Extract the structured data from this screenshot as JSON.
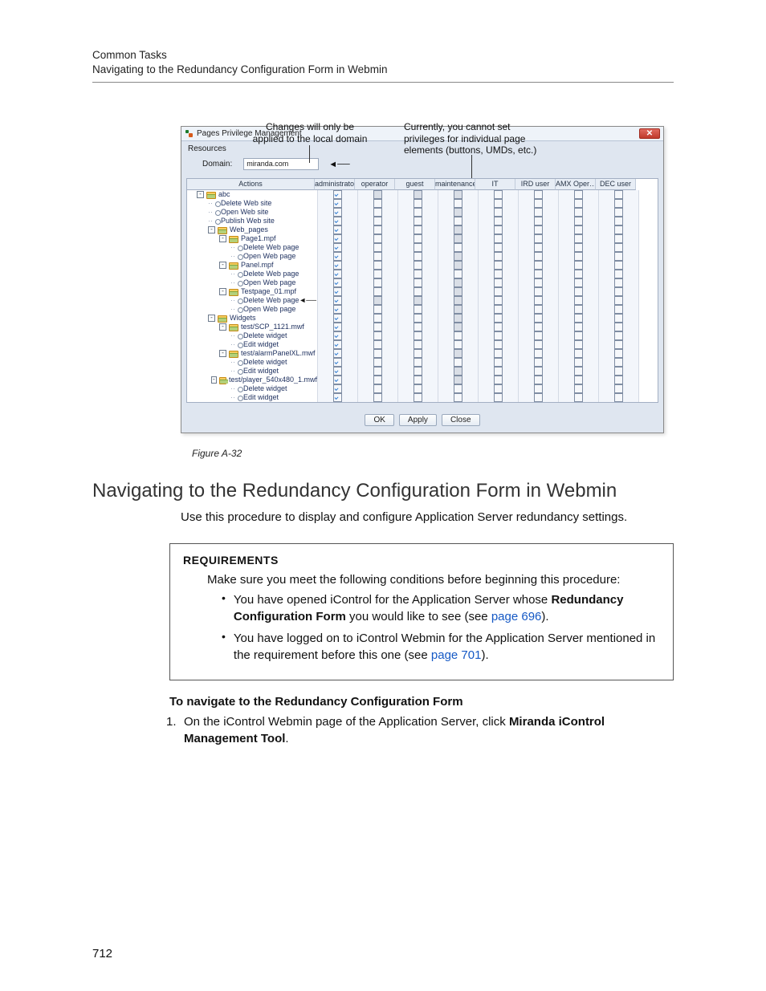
{
  "running_head": {
    "line1": "Common Tasks",
    "line2": "Navigating to the Redundancy Configuration Form in Webmin"
  },
  "annotations": {
    "left": "Changes will only be\napplied to the local domain",
    "right": "Currently, you cannot set\nprivileges for individual page\nelements (buttons, UMDs, etc.)"
  },
  "window": {
    "title": "Pages Privilege Management",
    "resources_label": "Resources",
    "domain_label": "Domain:",
    "domain_value": "miranda.com",
    "columns": [
      "Actions",
      "administrator",
      "operator",
      "guest",
      "maintenance",
      "IT",
      "IRD user",
      "AMX Oper…",
      "DEC user"
    ],
    "buttons": {
      "ok": "OK",
      "apply": "Apply",
      "close": "Close"
    }
  },
  "tree": [
    {
      "depth": 0,
      "exp": "-",
      "icon": "folder",
      "label": "abc",
      "checks": [
        1,
        2,
        2,
        2,
        0,
        0,
        0,
        0
      ]
    },
    {
      "depth": 1,
      "icon": "gear",
      "label": "Delete Web site",
      "checks": [
        1,
        0,
        0,
        0,
        0,
        0,
        0,
        0
      ]
    },
    {
      "depth": 1,
      "icon": "gear",
      "label": "Open Web site",
      "checks": [
        1,
        0,
        0,
        2,
        0,
        0,
        0,
        0
      ]
    },
    {
      "depth": 1,
      "icon": "gear",
      "label": "Publish Web site",
      "checks": [
        1,
        0,
        0,
        0,
        0,
        0,
        0,
        0
      ]
    },
    {
      "depth": 1,
      "exp": "-",
      "icon": "folder",
      "label": "Web_pages",
      "checks": [
        1,
        0,
        0,
        2,
        0,
        0,
        0,
        0
      ]
    },
    {
      "depth": 2,
      "exp": "-",
      "icon": "folder",
      "label": "Page1.mpf",
      "checks": [
        1,
        0,
        0,
        2,
        0,
        0,
        0,
        0
      ]
    },
    {
      "depth": 3,
      "icon": "gear",
      "label": "Delete Web page",
      "checks": [
        1,
        0,
        0,
        0,
        0,
        0,
        0,
        0
      ]
    },
    {
      "depth": 3,
      "icon": "gear",
      "label": "Open Web page",
      "checks": [
        1,
        0,
        0,
        2,
        0,
        0,
        0,
        0
      ]
    },
    {
      "depth": 2,
      "exp": "-",
      "icon": "folder",
      "label": "Panel.mpf",
      "checks": [
        1,
        0,
        0,
        2,
        0,
        0,
        0,
        0
      ]
    },
    {
      "depth": 3,
      "icon": "gear",
      "label": "Delete Web page",
      "checks": [
        1,
        0,
        0,
        0,
        0,
        0,
        0,
        0
      ]
    },
    {
      "depth": 3,
      "icon": "gear",
      "label": "Open Web page",
      "checks": [
        1,
        0,
        0,
        2,
        0,
        0,
        0,
        0
      ]
    },
    {
      "depth": 2,
      "exp": "-",
      "icon": "folder",
      "label": "Testpage_01.mpf",
      "checks": [
        1,
        0,
        0,
        2,
        0,
        0,
        0,
        0
      ]
    },
    {
      "depth": 3,
      "icon": "gear",
      "label": "Delete Web page",
      "checks": [
        1,
        2,
        2,
        2,
        0,
        0,
        0,
        0
      ],
      "ptr": true
    },
    {
      "depth": 3,
      "icon": "gear",
      "label": "Open Web page",
      "checks": [
        1,
        0,
        0,
        2,
        0,
        0,
        0,
        0
      ]
    },
    {
      "depth": 1,
      "exp": "-",
      "icon": "folder",
      "label": "Widgets",
      "checks": [
        1,
        0,
        0,
        2,
        0,
        0,
        0,
        0
      ]
    },
    {
      "depth": 2,
      "exp": "-",
      "icon": "folder",
      "label": "test/SCP_1121.mwf",
      "checks": [
        1,
        0,
        0,
        2,
        0,
        0,
        0,
        0
      ]
    },
    {
      "depth": 3,
      "icon": "gear",
      "label": "Delete widget",
      "checks": [
        1,
        0,
        0,
        0,
        0,
        0,
        0,
        0
      ]
    },
    {
      "depth": 3,
      "icon": "gear",
      "label": "Edit widget",
      "checks": [
        1,
        0,
        0,
        0,
        0,
        0,
        0,
        0
      ]
    },
    {
      "depth": 2,
      "exp": "-",
      "icon": "folder",
      "label": "test/alarmPanelXL.mwf",
      "checks": [
        1,
        0,
        0,
        2,
        0,
        0,
        0,
        0
      ]
    },
    {
      "depth": 3,
      "icon": "gear",
      "label": "Delete widget",
      "checks": [
        1,
        0,
        0,
        0,
        0,
        0,
        0,
        0
      ]
    },
    {
      "depth": 3,
      "icon": "gear",
      "label": "Edit widget",
      "checks": [
        1,
        0,
        0,
        2,
        0,
        0,
        0,
        0
      ]
    },
    {
      "depth": 2,
      "exp": "-",
      "icon": "folder",
      "label": "test/player_540x480_1.mwf",
      "checks": [
        1,
        0,
        0,
        2,
        0,
        0,
        0,
        0
      ]
    },
    {
      "depth": 3,
      "icon": "gear",
      "label": "Delete widget",
      "checks": [
        1,
        0,
        0,
        0,
        0,
        0,
        0,
        0
      ]
    },
    {
      "depth": 3,
      "icon": "gear",
      "label": "Edit widget",
      "checks": [
        1,
        0,
        0,
        0,
        0,
        0,
        0,
        0
      ]
    }
  ],
  "fig_caption": "Figure A-32",
  "heading": "Navigating to the Redundancy Configuration Form in Webmin",
  "intro": "Use this procedure to display and configure Application Server redundancy settings.",
  "box": {
    "title": "REQUIREMENTS",
    "lead": "Make sure you meet the following conditions before beginning this procedure:",
    "b1_a": "You have opened iControl for the Application Server whose ",
    "b1_bold": "Redundancy Configuration Form",
    "b1_b": " you would like to see (see ",
    "b1_link": "page 696",
    "b1_c": ").",
    "b2_a": "You have logged on to iControl Webmin for the Application Server mentioned in the requirement before this one (see ",
    "b2_link": "page 701",
    "b2_b": ")."
  },
  "subhead": "To navigate to the Redundancy Configuration Form",
  "step1_a": "On the iControl Webmin page of the Application Server, click ",
  "step1_bold": "Miranda iControl Management Tool",
  "step1_b": ".",
  "pagenum": "712"
}
